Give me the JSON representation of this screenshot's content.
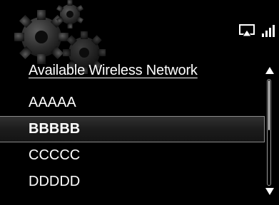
{
  "icons": {
    "decoration": "gears-icon",
    "airplay": "airplay-icon",
    "signal": "signal-strength-icon"
  },
  "wireless": {
    "title": "Available Wireless Network",
    "networks": [
      "AAAAA",
      "BBBBB",
      "CCCCC",
      "DDDDD"
    ],
    "selected_index": 1
  },
  "scroll": {
    "position_fraction": 0
  },
  "colors": {
    "background": "#000000",
    "text": "#ffffff",
    "selection_border": "#8c8c8c",
    "selection_fill": "#1c1c1c"
  }
}
